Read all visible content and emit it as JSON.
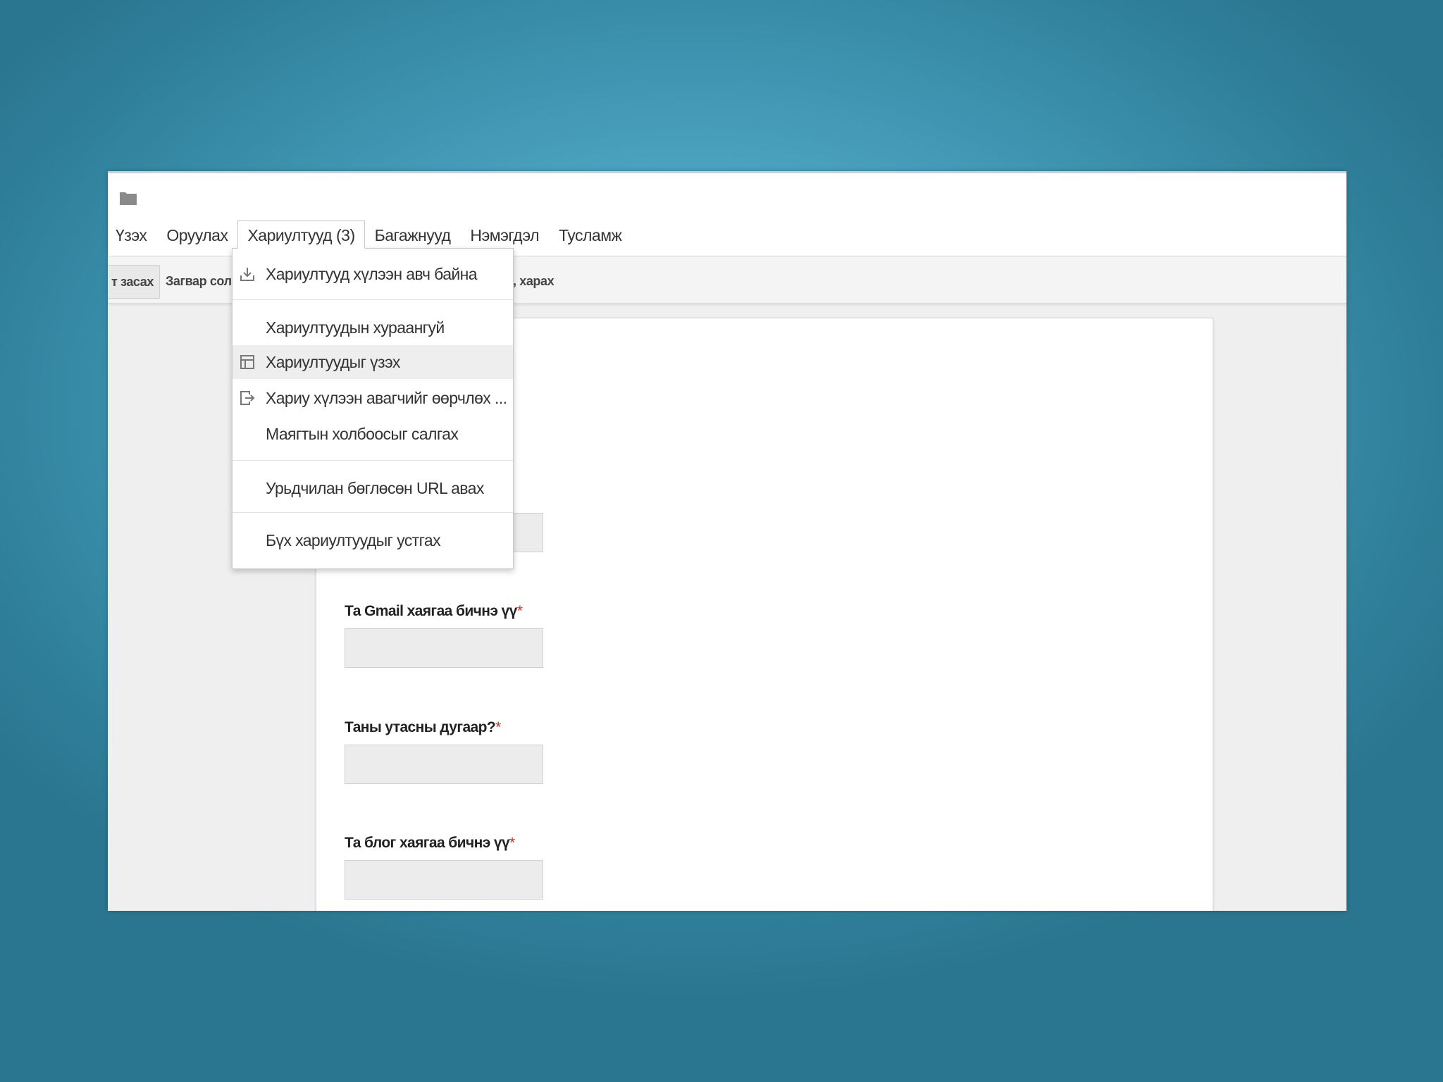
{
  "menubar": {
    "items": [
      {
        "label": "Үзэх"
      },
      {
        "label": "Оруулах"
      },
      {
        "label": "Хариултууд (3)"
      },
      {
        "label": "Багажнууд"
      },
      {
        "label": "Нэмэгдэл"
      },
      {
        "label": "Тусламж"
      }
    ]
  },
  "toolbar": {
    "edit_label": "т засах",
    "theme_label": "Загвар сол",
    "view_label": ", харах"
  },
  "responses_menu": {
    "items": [
      {
        "label": "Хариултууд хүлээн авч байна",
        "icon": "download-icon"
      },
      {
        "label": "Хариултуудын хураангуй"
      },
      {
        "label": "Хариултуудыг үзэх",
        "icon": "table-icon"
      },
      {
        "label": "Хариу хүлээн авагчийг өөрчлөх ...",
        "icon": "export-icon"
      },
      {
        "label": "Маягтын холбоосыг салгах"
      },
      {
        "label": "Урьдчилан бөглөсөн URL авах"
      },
      {
        "label": "Бүх хариултуудыг устгах"
      }
    ],
    "highlighted": "Хариултуудыг үзэх"
  },
  "form": {
    "fields": [
      {
        "label": "Та Gmail хаягаа бичнэ үү",
        "required_mark": "*",
        "value": ""
      },
      {
        "label": "Таны утасны дугаар?",
        "required_mark": "*",
        "value": ""
      },
      {
        "label": "Та блог хаягаа бичнэ үү",
        "required_mark": "*",
        "value": ""
      }
    ]
  },
  "colors": {
    "background": "#4aa3c0",
    "required": "#d93025",
    "highlight": "#eeeeee"
  }
}
